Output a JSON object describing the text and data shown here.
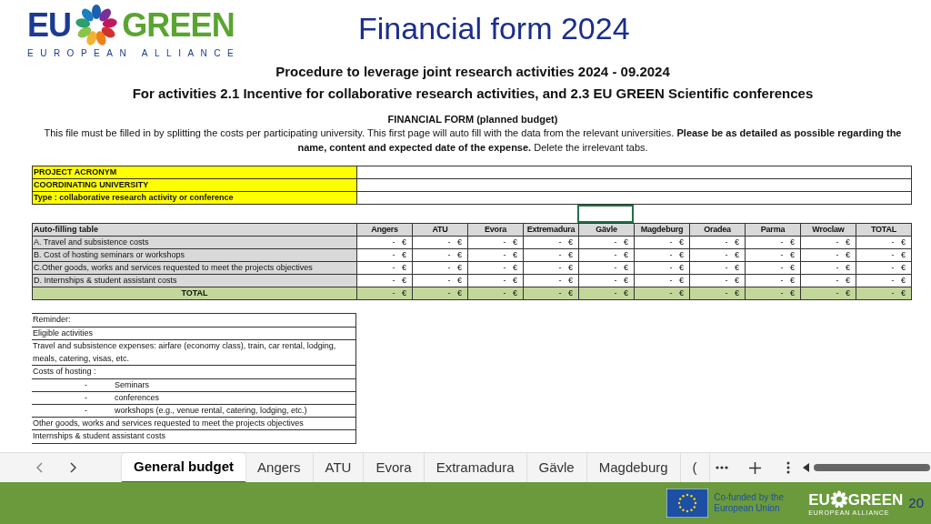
{
  "slide": {
    "title": "Financial form 2024",
    "logo": {
      "left": "EU",
      "right": "GREEN",
      "tagline": "EUROPEAN ALLIANCE"
    }
  },
  "sheet": {
    "headings": [
      "Procedure to leverage joint research activities 2024  - 09.2024",
      "For activities 2.1 Incentive for collaborative research activities, and 2.3 EU GREEN Scientific conferences"
    ],
    "form_title": "FINANCIAL FORM (planned budget)",
    "intro": "This file must be filled in by splitting the costs per participating university. This first page will auto fill with the data from the relevant universities. **Please be as detailed as possible regarding the name, content and expected date of the expense.** Delete the irrelevant tabs.",
    "project_fields": [
      "PROJECT ACRONYM",
      "COORDINATING UNIVERSITY",
      "Type : collaborative research activity or conference"
    ],
    "table": {
      "label_header": "Auto-filling table",
      "columns": [
        "Angers",
        "ATU",
        "Evora",
        "Extremadura",
        "Gävle",
        "Magdeburg",
        "Oradea",
        "Parma",
        "Wroclaw",
        "TOTAL"
      ],
      "rows": [
        {
          "label": "A. Travel and subsistence costs",
          "kind": "item",
          "cells": [
            "-   €",
            "-   €",
            "-   €",
            "-   €",
            "-   €",
            "-   €",
            "-   €",
            "-   €",
            "-   €",
            "-   €"
          ]
        },
        {
          "label": "B. Cost of hosting seminars or workshops",
          "kind": "item",
          "cells": [
            "-   €",
            "-   €",
            "-   €",
            "-   €",
            "-   €",
            "-   €",
            "-   €",
            "-   €",
            "-   €",
            "-   €"
          ]
        },
        {
          "label": "C.Other goods, works and services requested to meet the projects objectives",
          "kind": "item",
          "cells": [
            "-   €",
            "-   €",
            "-   €",
            "-   €",
            "-   €",
            "-   €",
            "-   €",
            "-   €",
            "-   €",
            "-   €"
          ]
        },
        {
          "label": "D. Internships & student assistant costs",
          "kind": "item",
          "cells": [
            "-   €",
            "-   €",
            "-   €",
            "-   €",
            "-   €",
            "-   €",
            "-   €",
            "-   €",
            "-   €",
            "-   €"
          ]
        },
        {
          "label": "TOTAL",
          "kind": "total",
          "cells": [
            "-   €",
            "-   €",
            "-   €",
            "-   €",
            "-   €",
            "-   €",
            "-   €",
            "-   €",
            "-   €",
            "-   €"
          ]
        }
      ]
    },
    "reminder": [
      {
        "kind": "line",
        "text": "Reminder:"
      },
      {
        "kind": "line",
        "text": "Eligible activities"
      },
      {
        "kind": "line",
        "text": "Travel and subsistence expenses: airfare (economy class), train, car rental, lodging, meals, catering, visas, etc."
      },
      {
        "kind": "line",
        "text": "Costs of hosting :"
      },
      {
        "kind": "bullet",
        "bullet": "-",
        "text": "Seminars"
      },
      {
        "kind": "bullet",
        "bullet": "-",
        "text": "conferences"
      },
      {
        "kind": "bullet",
        "bullet": "-",
        "text": "workshops (e.g., venue rental, catering, lodging, etc.)"
      },
      {
        "kind": "line",
        "text": "Other goods, works and services requested to meet the projects objectives"
      },
      {
        "kind": "line",
        "text": "Internships & student assistant costs"
      }
    ],
    "tabs": [
      {
        "label": "General budget",
        "selected": true
      },
      {
        "label": "Angers",
        "selected": false
      },
      {
        "label": "ATU",
        "selected": false
      },
      {
        "label": "Evora",
        "selected": false
      },
      {
        "label": "Extramadura",
        "selected": false
      },
      {
        "label": "Gävle",
        "selected": false
      },
      {
        "label": "Magdeburg",
        "selected": false
      },
      {
        "label": "(",
        "selected": false
      }
    ]
  },
  "footer": {
    "cofunded": "Co-funded by the European Union",
    "logo_left": "EU",
    "logo_right": "GREEN",
    "logo_tagline": "EUROPEAN ALLIANCE",
    "page_number": "20"
  }
}
